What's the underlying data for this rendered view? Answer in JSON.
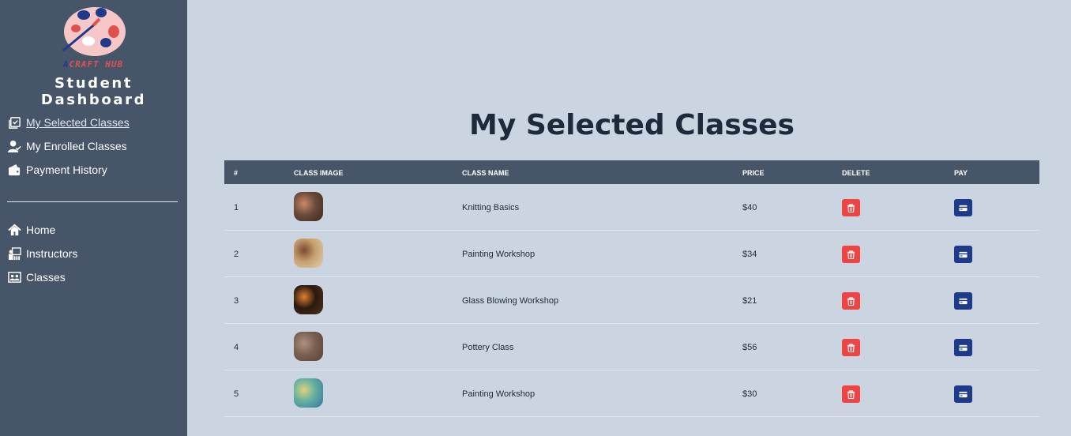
{
  "brand": {
    "logo_text_a": "A",
    "logo_text_rest": "CRAFT HUB",
    "dashboard_title": "Student Dashboard"
  },
  "sidebar": {
    "top_items": [
      {
        "label": "My Selected Classes",
        "icon": "checklist-icon",
        "active": true
      },
      {
        "label": "My Enrolled Classes",
        "icon": "user-check-icon",
        "active": false
      },
      {
        "label": "Payment History",
        "icon": "wallet-icon",
        "active": false
      }
    ],
    "bottom_items": [
      {
        "label": "Home",
        "icon": "home-icon"
      },
      {
        "label": "Instructors",
        "icon": "instructor-icon"
      },
      {
        "label": "Classes",
        "icon": "classes-icon"
      }
    ]
  },
  "main": {
    "title": "My Selected Classes",
    "columns": [
      "#",
      "CLASS IMAGE",
      "CLASS NAME",
      "PRICE",
      "DELETE",
      "PAY"
    ],
    "rows": [
      {
        "num": "1",
        "name": "Knitting Basics",
        "price": "$40",
        "thumb_colors": [
          "#6b4a3a",
          "#c98a6a",
          "#3a2a20"
        ]
      },
      {
        "num": "2",
        "name": "Painting Workshop",
        "price": "$34",
        "thumb_colors": [
          "#c8a070",
          "#7a4a30",
          "#e0d0b0"
        ]
      },
      {
        "num": "3",
        "name": "Glass Blowing Workshop",
        "price": "$21",
        "thumb_colors": [
          "#2a1a10",
          "#e08030",
          "#50301a"
        ]
      },
      {
        "num": "4",
        "name": "Pottery Class",
        "price": "$56",
        "thumb_colors": [
          "#7a6050",
          "#b09080",
          "#5a4030"
        ]
      },
      {
        "num": "5",
        "name": "Painting Workshop",
        "price": "$30",
        "thumb_colors": [
          "#60b0a0",
          "#e0d080",
          "#4070a0"
        ]
      }
    ]
  },
  "colors": {
    "sidebar_bg": "#475569",
    "page_bg": "#cbd5e1",
    "delete": "#ef4444",
    "pay": "#1e3a8a"
  }
}
